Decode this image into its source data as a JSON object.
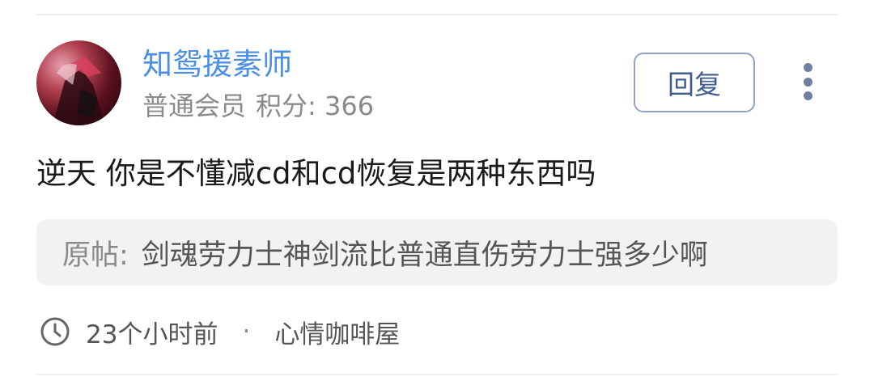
{
  "post": {
    "username": "知鸳援素师",
    "member_level": "普通会员",
    "points_label": "积分: 366",
    "reply_label": "回复",
    "content": "逆天 你是不懂减cd和cd恢复是两种东西吗",
    "quote_label": "原帖:",
    "quote_text": "剑魂劳力士神剑流比普通直伤劳力士强多少啊",
    "time": "23个小时前",
    "separator": "·",
    "board": "心情咖啡屋"
  },
  "colors": {
    "username": "#4a8ee8",
    "reply_border": "#8fa3c8",
    "reply_text": "#3f5c8f",
    "quote_bg": "#f2f2f2"
  }
}
